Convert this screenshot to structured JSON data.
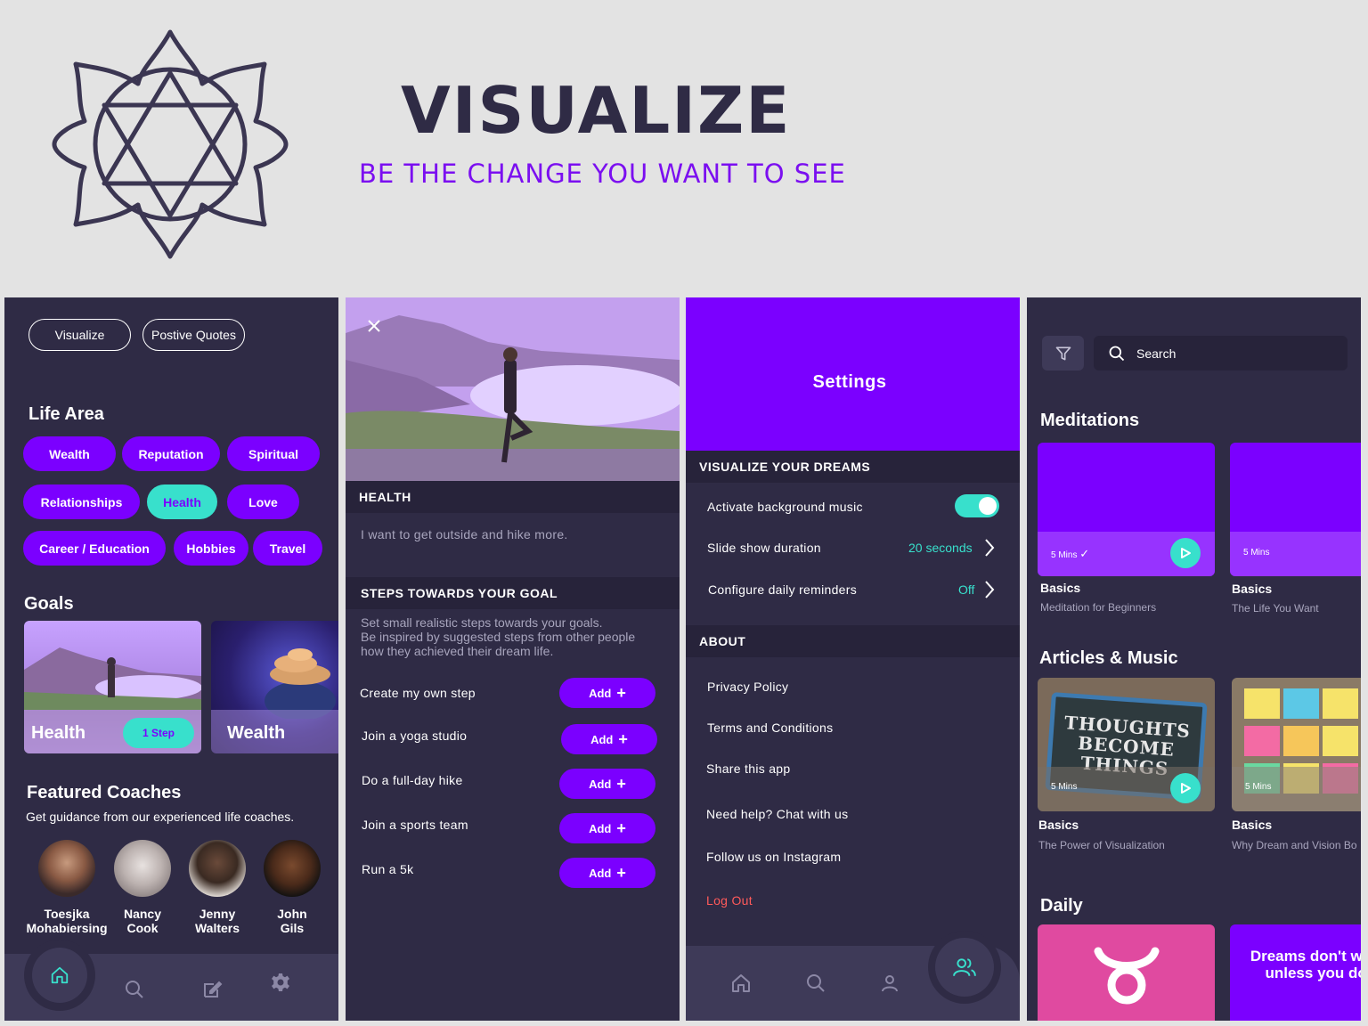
{
  "hero": {
    "title": "VISUALIZE",
    "subtitle": "BE THE CHANGE YOU WANT TO SEE",
    "logo_icon": "chakra-star-icon"
  },
  "colors": {
    "primary": "#7b00ff",
    "accent": "#38e0cc",
    "dark": "#2f2b45",
    "danger": "#ff5a5a"
  },
  "screen1": {
    "pills": [
      "Visualize",
      "Postive Quotes"
    ],
    "life_area_title": "Life Area",
    "tags": [
      "Wealth",
      "Reputation",
      "Spiritual",
      "Relationships",
      "Health",
      "Love",
      "Career / Education",
      "Hobbies",
      "Travel"
    ],
    "active_tag": "Health",
    "goals_title": "Goals",
    "goals": [
      {
        "label": "Health",
        "badge": "1 Step"
      },
      {
        "label": "Wealth"
      }
    ],
    "featured_title": "Featured Coaches",
    "featured_sub": "Get guidance from our experienced life coaches.",
    "coaches": [
      {
        "first": "Toesjka",
        "last": "Mohabiersing"
      },
      {
        "first": "Nancy",
        "last": "Cook"
      },
      {
        "first": "Jenny",
        "last": "Walters"
      },
      {
        "first": "John",
        "last": "Gils"
      }
    ],
    "nav": [
      "home-icon",
      "search-icon",
      "edit-icon",
      "gear-icon"
    ]
  },
  "screen2": {
    "close_icon": "close-icon",
    "section1": "HEALTH",
    "goal_text": "I want to get outside and hike more.",
    "section2": "STEPS TOWARDS YOUR GOAL",
    "helper_lines": [
      "Set small realistic steps towards your goals.",
      "Be inspired by suggested steps from other people",
      "how they achieved their dream life."
    ],
    "steps": [
      "Create my own step",
      "Join a yoga studio",
      "Do a full-day hike",
      "Join a sports team",
      "Run a 5k"
    ],
    "add_label": "Add"
  },
  "screen3": {
    "title": "Settings",
    "section1": "VISUALIZE YOUR DREAMS",
    "bg_music": "Activate background music",
    "bg_music_on": true,
    "slide_label": "Slide show duration",
    "slide_value": "20 seconds",
    "reminders_label": "Configure daily reminders",
    "reminders_value": "Off",
    "section2": "ABOUT",
    "about": [
      "Privacy Policy",
      "Terms and Conditions",
      "Share this app",
      "Need help? Chat with us",
      "Follow us on Instagram"
    ],
    "logout": "Log Out",
    "nav": [
      "home-icon",
      "search-icon",
      "profile-icon",
      "people-icon"
    ]
  },
  "screen4": {
    "search_placeholder": "Search",
    "meditations_title": "Meditations",
    "meditations": [
      {
        "mins": "5 Mins",
        "title": "Basics",
        "sub": "Meditation for Beginners",
        "done": true
      },
      {
        "mins": "5 Mins",
        "title": "Basics",
        "sub": "The Life You Want",
        "done": false
      }
    ],
    "articles_title": "Articles & Music",
    "articles": [
      {
        "mins": "5 Mins",
        "title": "Basics",
        "sub": "The Power of Visualization",
        "image_text": "THOUGHTS BECOME THINGS"
      },
      {
        "mins": "5 Mins",
        "title": "Basics",
        "sub": "Why Dream and Vision Bo"
      }
    ],
    "daily_title": "Daily",
    "daily_quote": "Dreams don't work unless you do."
  }
}
